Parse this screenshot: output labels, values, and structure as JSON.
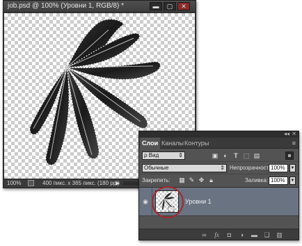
{
  "document": {
    "title": "job.psd @ 100% (Уровни 1, RGB/8) *",
    "controls": {
      "minimize": "▬",
      "maximize": "▢",
      "close": "✕"
    },
    "status": {
      "zoom": "100%",
      "info": "400 пикс. x 365 пикс. (180 ppi)",
      "arrow": "▶"
    }
  },
  "layers_panel": {
    "header_icons": {
      "collapse": "◂◂",
      "close": "✕",
      "menu": "≡"
    },
    "tabs": [
      {
        "label": "Слои",
        "active": true
      },
      {
        "label": "Каналы",
        "active": false
      },
      {
        "label": "Контуры",
        "active": false
      }
    ],
    "filter": {
      "kind": "ρ Вид",
      "arrow": "⇕",
      "icons": [
        "image-filter-icon",
        "adjustment-filter-icon",
        "type-filter-icon",
        "shape-filter-icon",
        "smart-object-filter-icon"
      ]
    },
    "blend": {
      "mode": "Обычные",
      "arrow": "⇕",
      "opacity_label": "Непрозрачность:",
      "opacity_value": "100%",
      "dropdown_arrow": "▼"
    },
    "lock": {
      "label": "Закрепить:",
      "fill_label": "Заливка:",
      "fill_value": "100%"
    },
    "layers": [
      {
        "name": "Уровни 1",
        "visible": true,
        "selected": true
      }
    ],
    "highlight_color": "#a4282c",
    "selected_row_color": "#6a7381"
  }
}
